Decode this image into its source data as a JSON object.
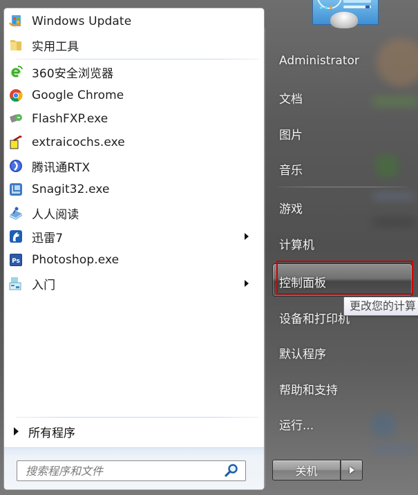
{
  "start_menu": {
    "pinned_programs": [
      {
        "label": "Windows Update",
        "icon": "windows-update-icon",
        "has_submenu": false
      },
      {
        "label": "实用工具",
        "icon": "folder-icon",
        "has_submenu": false
      }
    ],
    "recent_programs": [
      {
        "label": "360安全浏览器",
        "icon": "360-browser-icon",
        "has_submenu": false
      },
      {
        "label": "Google Chrome",
        "icon": "chrome-icon",
        "has_submenu": false
      },
      {
        "label": "FlashFXP.exe",
        "icon": "flashfxp-icon",
        "has_submenu": false
      },
      {
        "label": "extraicochs.exe",
        "icon": "extraico-icon",
        "has_submenu": false
      },
      {
        "label": "腾讯通RTX",
        "icon": "rtx-icon",
        "has_submenu": false
      },
      {
        "label": "Snagit32.exe",
        "icon": "snagit-icon",
        "has_submenu": false
      },
      {
        "label": "人人阅读",
        "icon": "renren-reader-icon",
        "has_submenu": false
      },
      {
        "label": "迅雷7",
        "icon": "thunder-icon",
        "has_submenu": true
      },
      {
        "label": "Photoshop.exe",
        "icon": "photoshop-icon",
        "has_submenu": false
      },
      {
        "label": "入门",
        "icon": "getting-started-icon",
        "has_submenu": true
      }
    ],
    "all_programs_label": "所有程序",
    "search": {
      "placeholder": "搜索程序和文件",
      "value": ""
    },
    "right_panel": {
      "user_name": "Administrator",
      "items": [
        {
          "label": "文档"
        },
        {
          "label": "图片"
        },
        {
          "label": "音乐"
        },
        {
          "label": "游戏"
        },
        {
          "label": "计算机"
        },
        {
          "label": "控制面板",
          "highlighted": true
        },
        {
          "label": "设备和打印机"
        },
        {
          "label": "默认程序"
        },
        {
          "label": "帮助和支持"
        },
        {
          "label": "运行..."
        }
      ],
      "tooltip": "更改您的计算",
      "shutdown_label": "关机"
    },
    "colors": {
      "highlight_annotation": "#d00000",
      "right_panel_text": "#f4f4f4",
      "left_panel_bg": "#ffffff"
    }
  }
}
